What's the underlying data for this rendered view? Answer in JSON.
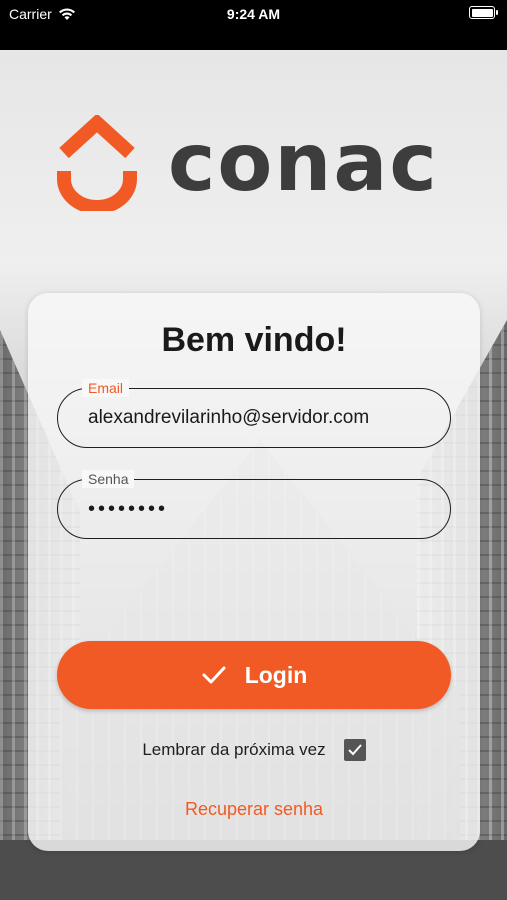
{
  "status_bar": {
    "carrier": "Carrier",
    "time": "9:24 AM"
  },
  "brand": {
    "logo_text": "conac",
    "accent": "#f15a24",
    "dark": "#3d3d3d"
  },
  "card": {
    "title": "Bem vindo!",
    "email": {
      "label": "Email",
      "value": "alexandrevilarinho@servidor.com"
    },
    "password": {
      "label": "Senha",
      "masked_value": "••••••••"
    },
    "login_button": {
      "label": "Login",
      "icon": "check-icon"
    },
    "remember": {
      "label": "Lembrar da próxima vez",
      "checked": true
    },
    "recover_link": "Recuperar senha"
  }
}
